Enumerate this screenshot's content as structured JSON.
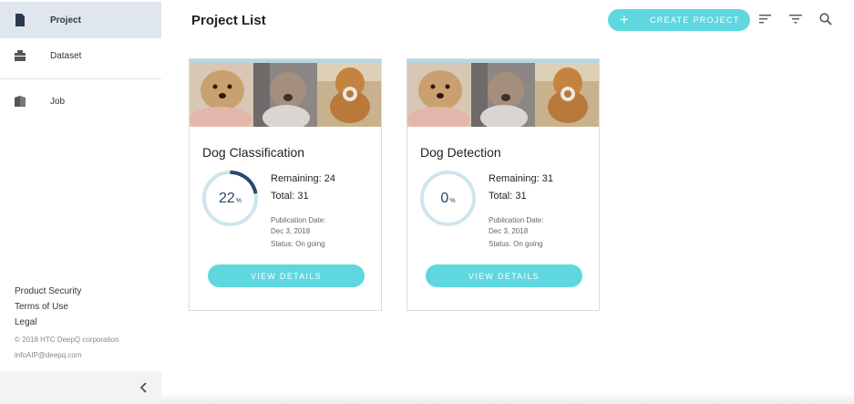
{
  "sidebar": {
    "items": [
      {
        "label": "Project",
        "icon": "document-icon"
      },
      {
        "label": "Dataset",
        "icon": "folder-icon"
      },
      {
        "label": "Job",
        "icon": "book-icon"
      }
    ],
    "footer": {
      "links": [
        "Product Security",
        "Terms of Use",
        "Legal"
      ],
      "copyright": "© 2018 HTC DeepQ corporation",
      "email": "infoAIP@deepq.com"
    }
  },
  "header": {
    "title": "Project List",
    "create_label": "CREATE PROJECT",
    "create_icon": "+"
  },
  "projects": [
    {
      "title": "Dog Classification",
      "progress_value": "22",
      "progress_unit": "%",
      "progress_fraction": 0.22,
      "remaining": "Remaining: 24",
      "total": "Total: 31",
      "pub_label": "Publication Date:",
      "pub_date": "Dec 3, 2018",
      "status": "Status: On going",
      "button": "VIEW DETAILS"
    },
    {
      "title": "Dog Detection",
      "progress_value": "0",
      "progress_unit": "%",
      "progress_fraction": 0,
      "remaining": "Remaining: 31",
      "total": "Total: 31",
      "pub_label": "Publication Date:",
      "pub_date": "Dec 3, 2018",
      "status": "Status: On going",
      "button": "VIEW DETAILS"
    }
  ],
  "colors": {
    "accent": "#5fd7df",
    "ring_track": "#cfe5ec",
    "ring_fill": "#27496a",
    "active_nav": "#dfe6ee"
  }
}
